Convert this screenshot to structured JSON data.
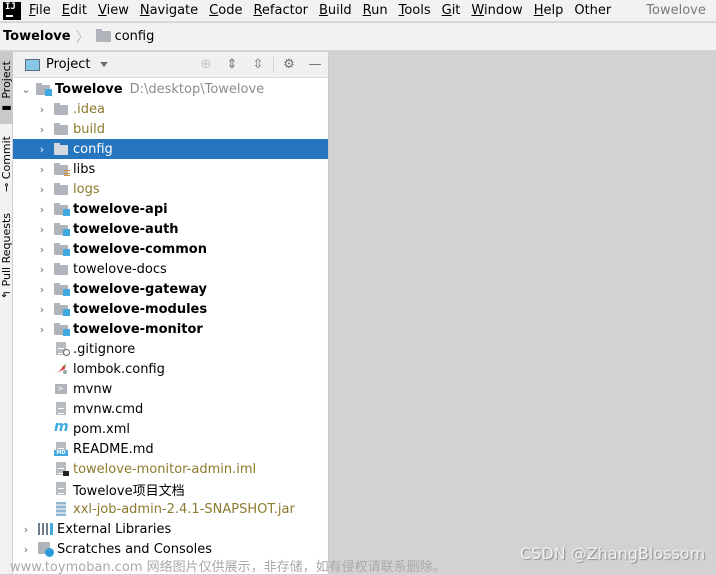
{
  "menubar": {
    "items": [
      {
        "label": "File",
        "mnemonic": "F",
        "rest": "ile"
      },
      {
        "label": "Edit",
        "mnemonic": "E",
        "rest": "dit"
      },
      {
        "label": "View",
        "mnemonic": "V",
        "rest": "iew"
      },
      {
        "label": "Navigate",
        "mnemonic": "N",
        "rest": "avigate"
      },
      {
        "label": "Code",
        "mnemonic": "C",
        "rest": "ode"
      },
      {
        "label": "Refactor",
        "mnemonic": "R",
        "rest": "efactor"
      },
      {
        "label": "Build",
        "mnemonic": "B",
        "rest": "uild"
      },
      {
        "label": "Run",
        "mnemonic": "R",
        "rest": "un"
      },
      {
        "label": "Tools",
        "mnemonic": "T",
        "rest": "ools"
      },
      {
        "label": "Git",
        "mnemonic": "G",
        "rest": "it"
      },
      {
        "label": "Window",
        "mnemonic": "W",
        "rest": "indow"
      },
      {
        "label": "Help",
        "mnemonic": "H",
        "rest": "elp"
      },
      {
        "label": "Other",
        "mnemonic": "",
        "rest": "Other"
      }
    ],
    "window_title": "Towelove",
    "logo_text": "IJ"
  },
  "navbar": {
    "root": "Towelove",
    "leaf": "config"
  },
  "side_tabs": [
    {
      "label": "Project",
      "icon": "folder-icon"
    },
    {
      "label": "Commit",
      "icon": "commit-icon"
    },
    {
      "label": "Pull Requests",
      "icon": "pull-request-icon"
    }
  ],
  "panel": {
    "title": "Project",
    "tools": [
      "locate-icon",
      "expand-all-icon",
      "collapse-all-icon",
      "gear-icon",
      "minimize-icon"
    ]
  },
  "tree": {
    "root": {
      "name": "Towelove",
      "path": "D:\\desktop\\Towelove"
    },
    "children": [
      {
        "name": ".idea",
        "type": "folder",
        "style": "excluded"
      },
      {
        "name": "build",
        "type": "folder",
        "style": "excluded"
      },
      {
        "name": "config",
        "type": "folder",
        "style": "normal",
        "selected": true
      },
      {
        "name": "libs",
        "type": "libs-folder",
        "style": "normal"
      },
      {
        "name": "logs",
        "type": "folder",
        "style": "excluded"
      },
      {
        "name": "towelove-api",
        "type": "module",
        "style": "bold"
      },
      {
        "name": "towelove-auth",
        "type": "module",
        "style": "bold"
      },
      {
        "name": "towelove-common",
        "type": "module",
        "style": "bold"
      },
      {
        "name": "towelove-docs",
        "type": "folder",
        "style": "normal"
      },
      {
        "name": "towelove-gateway",
        "type": "module",
        "style": "bold"
      },
      {
        "name": "towelove-modules",
        "type": "module",
        "style": "bold"
      },
      {
        "name": "towelove-monitor",
        "type": "module",
        "style": "bold"
      },
      {
        "name": ".gitignore",
        "type": "gitignore",
        "style": "normal"
      },
      {
        "name": "lombok.config",
        "type": "lombok",
        "style": "normal"
      },
      {
        "name": "mvnw",
        "type": "shell",
        "style": "normal"
      },
      {
        "name": "mvnw.cmd",
        "type": "text",
        "style": "normal"
      },
      {
        "name": "pom.xml",
        "type": "maven",
        "style": "normal"
      },
      {
        "name": "README.md",
        "type": "markdown",
        "style": "normal"
      },
      {
        "name": "towelove-monitor-admin.iml",
        "type": "iml",
        "style": "excluded"
      },
      {
        "name": "Towelove项目文档",
        "type": "text",
        "style": "normal"
      },
      {
        "name": "xxl-job-admin-2.4.1-SNAPSHOT.jar",
        "type": "jar",
        "style": "excluded"
      }
    ],
    "bottom": [
      {
        "name": "External Libraries",
        "type": "external-libraries"
      },
      {
        "name": "Scratches and Consoles",
        "type": "scratches"
      }
    ]
  },
  "watermarks": {
    "left": "www.toymoban.com 网络图片仅供展示，非存储，如有侵权请联系删除。",
    "right": "CSDN @ZhangBlossom"
  }
}
